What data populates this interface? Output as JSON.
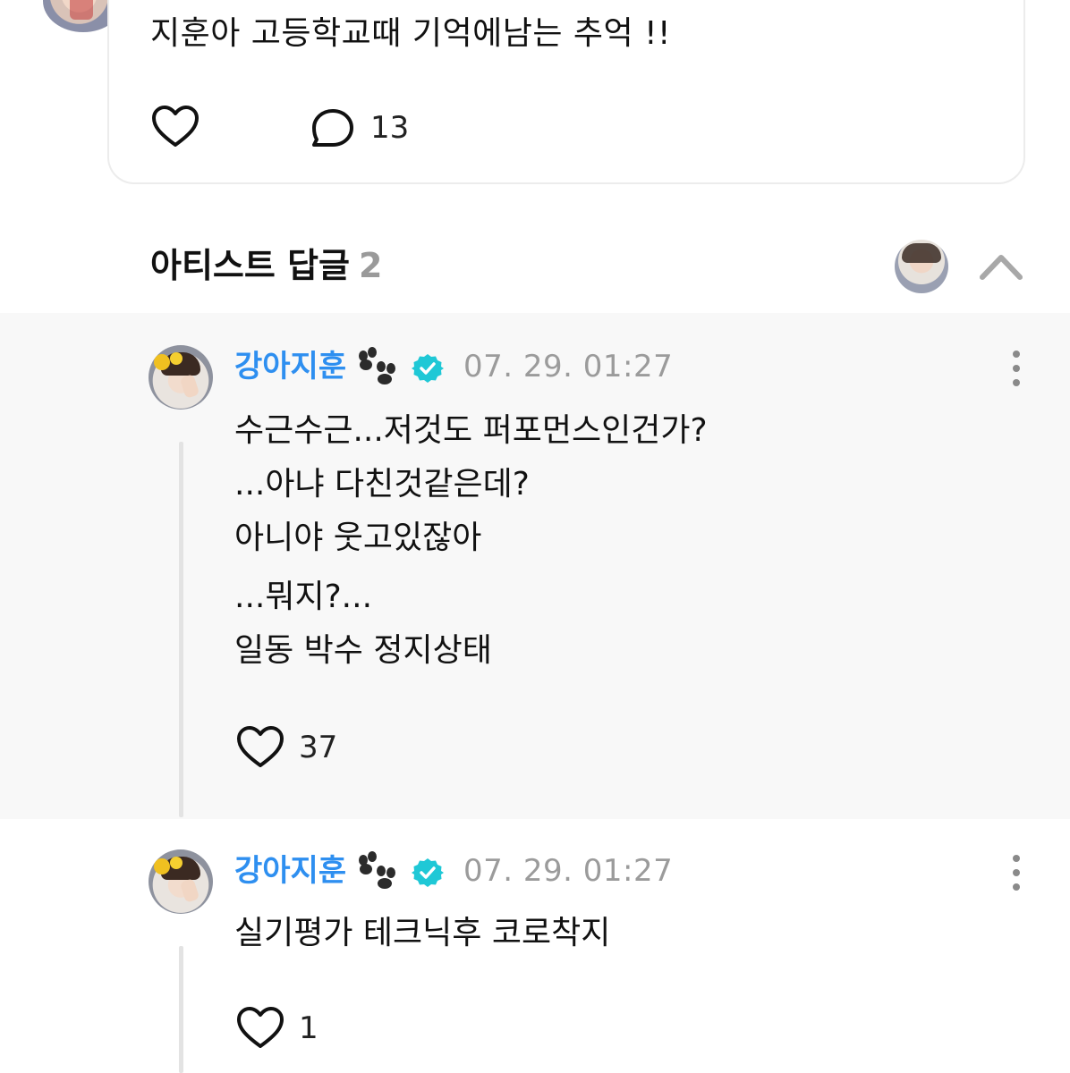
{
  "post": {
    "text": "지훈아 고등학교때 기억에남는 추억 !!",
    "comment_count": "13"
  },
  "artist_replies": {
    "title": "아티스트 답글",
    "count": "2"
  },
  "replies": [
    {
      "author": "강아지훈",
      "timestamp": "07. 29. 01:27",
      "lines": [
        "수근수근...저것도 퍼포먼스인건가?",
        "...아냐 다친것같은데?",
        "아니야 웃고있잖아",
        "...뭐지?...",
        "일동 박수 정지상태"
      ],
      "likes": "37"
    },
    {
      "author": "강아지훈",
      "timestamp": "07. 29. 01:27",
      "lines": [
        "실기평가 테크닉후 코로착지"
      ],
      "likes": "1"
    }
  ],
  "colors": {
    "author": "#2e8ff0",
    "verified": "#1fc8d6",
    "timestamp": "#9b9b9b",
    "reply_highlight_bg": "#f8f8f8"
  },
  "icons": [
    "heart-icon",
    "comment-bubble-icon",
    "paw-icon",
    "verified-badge-icon",
    "chevron-up-icon",
    "more-vertical-icon"
  ]
}
